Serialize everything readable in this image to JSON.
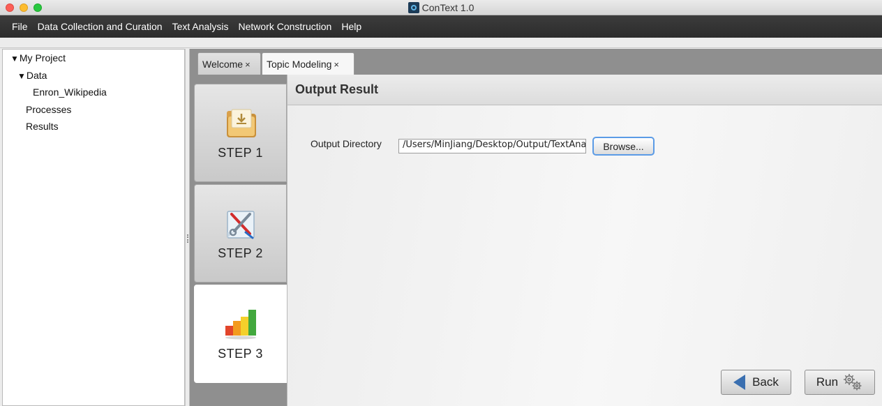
{
  "window": {
    "title": "ConText 1.0"
  },
  "menu": [
    "File",
    "Data Collection and Curation",
    "Text Analysis",
    "Network Construction",
    "Help"
  ],
  "tree": {
    "root": "My Project",
    "data": "Data",
    "dataset": "Enron_Wikipedia",
    "processes": "Processes",
    "results": "Results",
    "expanded_glyph": "▼"
  },
  "tabs": [
    {
      "label": "Welcome",
      "close": "×"
    },
    {
      "label": "Topic Modeling",
      "close": "×"
    }
  ],
  "steps": [
    {
      "label": "STEP 1",
      "icon": "folder-download-icon"
    },
    {
      "label": "STEP 2",
      "icon": "tools-document-icon"
    },
    {
      "label": "STEP 3",
      "icon": "bar-chart-icon"
    }
  ],
  "panel": {
    "title": "Output Result",
    "output_label": "Output Directory",
    "output_value": "/Users/MinJiang/Desktop/Output/TextAnalysis",
    "browse_label": "Browse...",
    "back_label": "Back",
    "run_label": "Run"
  },
  "colors": {
    "menubar": "#333333",
    "accent": "#5b9be6",
    "back_arrow": "#3a6fb0"
  }
}
